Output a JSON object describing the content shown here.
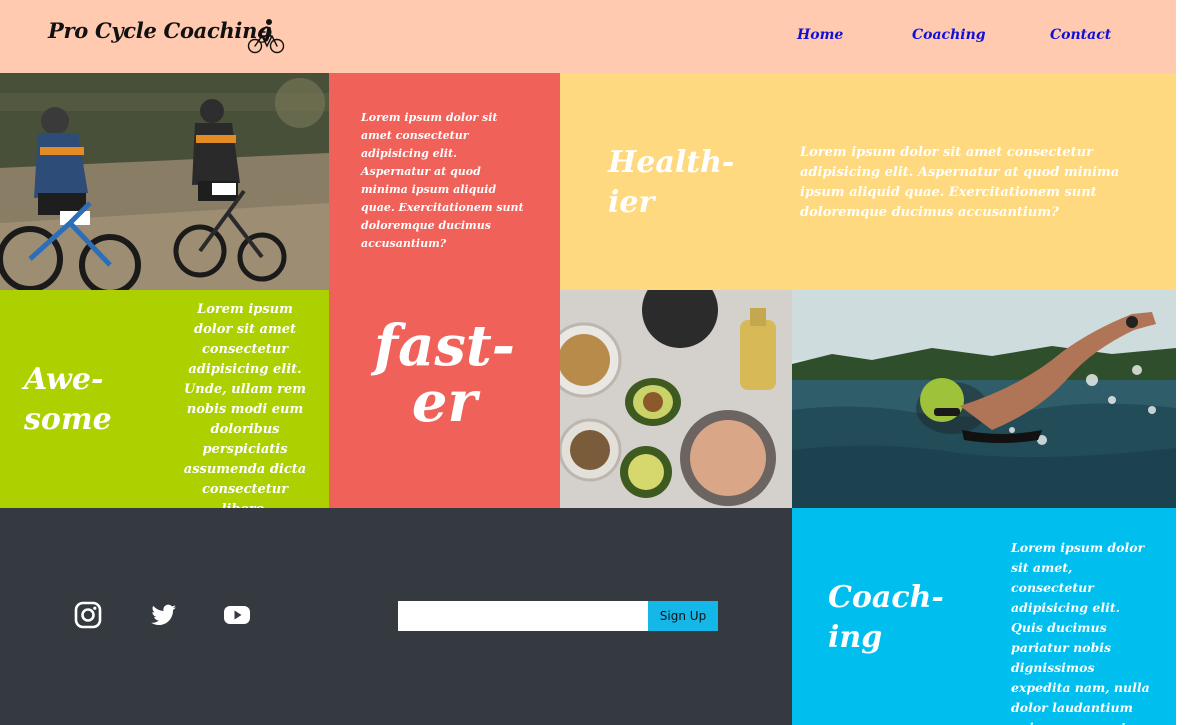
{
  "header": {
    "brand": "Pro Cycle Coaching",
    "brand_icon": "cyclist-icon",
    "nav": [
      "Home",
      "Coaching",
      "Contact"
    ]
  },
  "tiles": {
    "cyclists_photo": "mountain-bikers-photo",
    "red_text": "Lorem ipsum dolor sit amet consectetur adipisicing elit. Aspernatur at quod minima ipsum aliquid quae. Exercitationem sunt doloremque ducimus accusantium?",
    "healthier_heading": [
      "Health-",
      "ier"
    ],
    "yellow_text": "Lorem ipsum dolor sit amet consectetur adipisicing elit. Aspernatur at quod minima ipsum aliquid quae. Exercitationem sunt doloremque ducimus accusantium?",
    "awesome_heading": [
      "Awe-",
      "some"
    ],
    "green_text": "Lorem ipsum dolor sit amet consectetur adipisicing elit. Unde, ullam rem nobis modi eum doloribus perspiciatis assumenda dicta consectetur libero.",
    "faster_heading": [
      "fast-",
      "er"
    ],
    "food_photo": "healthy-food-photo",
    "swimmer_photo": "swimmer-photo",
    "coaching_heading": [
      "Coach-",
      "ing"
    ],
    "blue_text": "Lorem ipsum dolor sit amet, consectetur adipisicing elit. Quis ducimus pariatur nobis dignissimos expedita nam, nulla dolor laudantium quisquam error!"
  },
  "footer": {
    "social": [
      "instagram-icon",
      "twitter-icon",
      "youtube-icon"
    ],
    "email_value": "",
    "email_placeholder": "",
    "signup_label": "Sign Up"
  },
  "colors": {
    "header": "#ffcaaf",
    "red": "#ef6159",
    "yellow": "#ffd97f",
    "green": "#add000",
    "blue": "#00bfee",
    "footer": "#343a40",
    "nav_link": "#1010d8"
  }
}
